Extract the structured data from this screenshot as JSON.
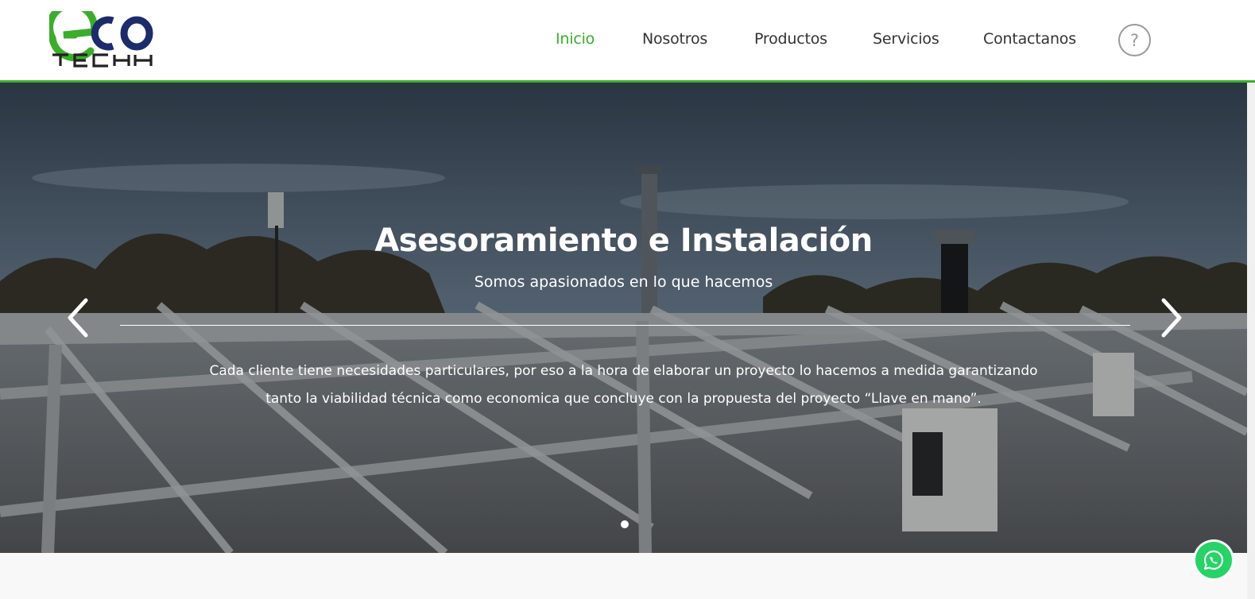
{
  "brand": {
    "logo_top": "ECO",
    "logo_bottom": "TECH",
    "green": "#3aae2a",
    "navy": "#1c2b6b"
  },
  "nav": {
    "items": [
      {
        "label": "Inicio",
        "active": true
      },
      {
        "label": "Nosotros",
        "active": false
      },
      {
        "label": "Productos",
        "active": false
      },
      {
        "label": "Servicios",
        "active": false
      },
      {
        "label": "Contactanos",
        "active": false
      }
    ],
    "help_label": "?",
    "help_icon": "question-circle-icon"
  },
  "hero": {
    "title": "Asesoramiento e Instalación",
    "subtitle": "Somos apasionados en lo que hacemos",
    "body": "Cada cliente tiene necesidades particulares, por eso a la hora de elaborar un proyecto lo hacemos a medida garantizando tanto la viabilidad técnica como economica que concluye con la propuesta del proyecto “Llave en mano”.",
    "prev_icon": "chevron-left-icon",
    "next_icon": "chevron-right-icon",
    "slide_count": 1,
    "active_slide": 1
  },
  "whatsapp": {
    "icon": "whatsapp-icon",
    "color": "#25d366"
  }
}
